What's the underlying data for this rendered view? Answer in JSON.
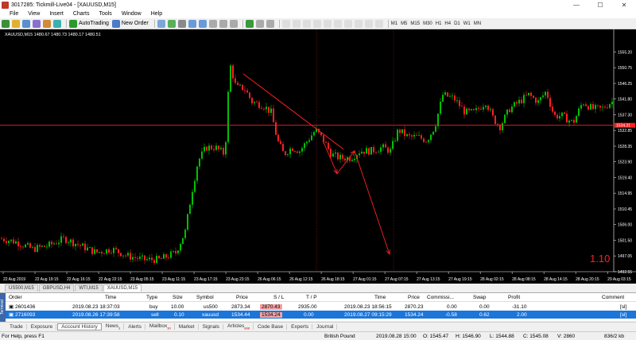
{
  "window": {
    "title": "3017285: Tickmill-Live04 - [XAUUSD,M15]",
    "min": "—",
    "max": "☐",
    "close": "✕"
  },
  "menu": [
    "File",
    "View",
    "Insert",
    "Charts",
    "Tools",
    "Window",
    "Help"
  ],
  "toolbar": {
    "autotrading": "AutoTrading",
    "neworder": "New Order",
    "timeframes": [
      "M1",
      "M5",
      "M15",
      "M30",
      "H1",
      "H4",
      "D1",
      "W1",
      "MN"
    ]
  },
  "chart": {
    "header": "XAUUSD,M15  1480.67 1480.73 1480.17 1480.51",
    "big_label": "1.10",
    "current_price_label": "1534.31",
    "colors": {
      "bull": "#00c000",
      "bear": "#ff2020",
      "bg": "#000000",
      "line": "#ff2020"
    }
  },
  "chart_data": {
    "type": "candlestick",
    "ylim": [
      1492.55,
      1559.85
    ],
    "yticks": [
      "1555.20",
      "1550.75",
      "1546.25",
      "1541.80",
      "1537.30",
      "1532.85",
      "1528.35",
      "1523.90",
      "1519.40",
      "1514.95",
      "1510.45",
      "1506.00",
      "1501.50",
      "1497.05",
      "1492.55"
    ],
    "xticks": [
      "22 Aug 2019",
      "22 Aug 19:15",
      "22 Aug 16:15",
      "22 Aug 22:15",
      "23 Aug 05:15",
      "23 Aug 11:15",
      "23 Aug 17:15",
      "23 Aug 23:15",
      "26 Aug 06:15",
      "26 Aug 12:15",
      "26 Aug 18:15",
      "27 Aug 01:15",
      "27 Aug 07:15",
      "27 Aug 13:15",
      "27 Aug 19:15",
      "28 Aug 02:15",
      "28 Aug 08:15",
      "28 Aug 14:15",
      "28 Aug 20:15",
      "29 Aug 03:15"
    ],
    "horizontal_level": 1534.31
  },
  "chart_tabs": [
    "US500,M15",
    "GBPUSD,H4",
    "WTI,M15",
    "XAUUSD,M15"
  ],
  "terminal": {
    "side_label": "Terminal",
    "headers": {
      "order": "Order",
      "time": "Time",
      "type": "Type",
      "size": "Size",
      "symbol": "Symbol",
      "price": "Price",
      "sl": "S / L",
      "tp": "T / P",
      "ctime": "Time",
      "cprice": "Price",
      "commission": "Commissi...",
      "swap": "Swap",
      "profit": "Profit",
      "comment": "Comment"
    },
    "rows": [
      {
        "order": "2601436",
        "time": "2019.08.23 18:37:03",
        "type": "buy",
        "size": "10.00",
        "symbol": "us500",
        "price": "2873.34",
        "sl": "2870.43",
        "tp": "2935.00",
        "ctime": "2019.08.23 18:56:15",
        "cprice": "2870.23",
        "commission": "0.00",
        "swap": "0.00",
        "profit": "-31.10",
        "comment": "[sl]"
      },
      {
        "order": "2716093",
        "time": "2019.08.26 17:39:58",
        "type": "sell",
        "size": "0.10",
        "symbol": "xauusd",
        "price": "1534.44",
        "sl": "1534.24",
        "tp": "0.00",
        "ctime": "2019.08.27 09:15:29",
        "cprice": "1534.24",
        "commission": "-0.58",
        "swap": "0.62",
        "profit": "2.00",
        "comment": "[sl]"
      }
    ]
  },
  "bottom_tabs": [
    {
      "label": "Trade",
      "badge": ""
    },
    {
      "label": "Exposure",
      "badge": ""
    },
    {
      "label": "Account History",
      "badge": "",
      "active": true
    },
    {
      "label": "News",
      "badge": "3"
    },
    {
      "label": "Alerts",
      "badge": ""
    },
    {
      "label": "Mailbox",
      "badge": "30"
    },
    {
      "label": "Market",
      "badge": ""
    },
    {
      "label": "Signals",
      "badge": ""
    },
    {
      "label": "Articles",
      "badge": "888"
    },
    {
      "label": "Code Base",
      "badge": ""
    },
    {
      "label": "Experts",
      "badge": ""
    },
    {
      "label": "Journal",
      "badge": ""
    }
  ],
  "status": {
    "help": "For Help, press F1",
    "profile": "British Pound",
    "datetime": "2019.08.28 15:00",
    "open": "O: 1545.47",
    "high": "H: 1546.90",
    "low": "L: 1544.88",
    "close": "C: 1545.08",
    "volume": "V: 2860",
    "traffic": "836/2 kb"
  }
}
